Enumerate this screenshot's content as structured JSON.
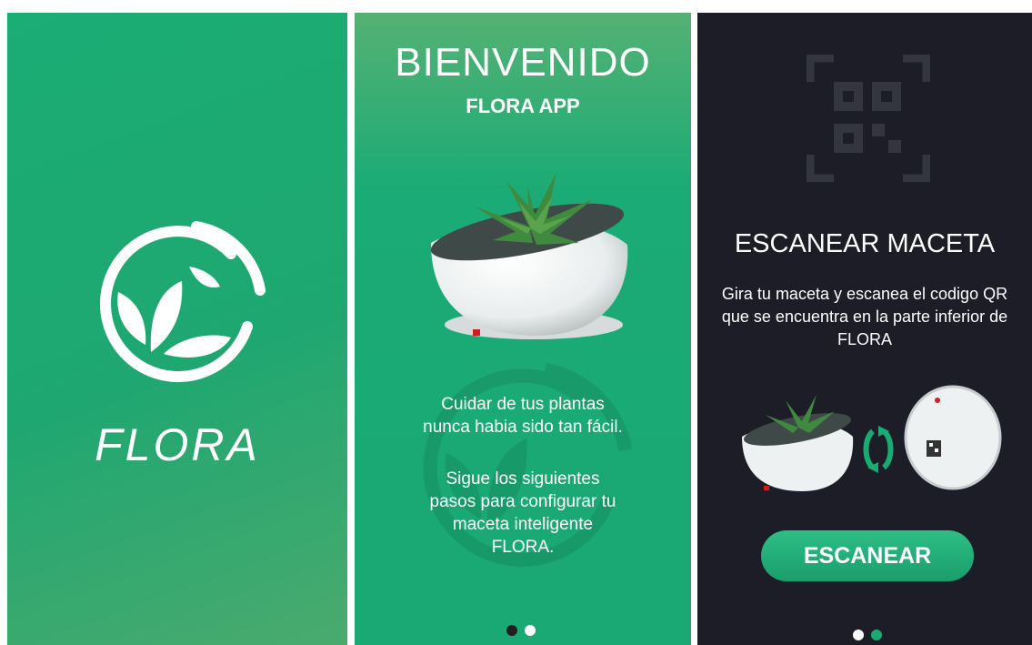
{
  "splash": {
    "brand": "FLORA",
    "logo_icon": "leaf-logo-icon"
  },
  "welcome": {
    "title": "BIENVENIDO",
    "subtitle": "FLORA APP",
    "paragraph1": "Cuidar de tus plantas nunca habia sido tan fácil.",
    "paragraph2": "Sigue los siguientes pasos para configurar tu maceta inteligente FLORA.",
    "page_indicator": {
      "count": 2,
      "active": 1
    }
  },
  "scan": {
    "title": "ESCANEAR MACETA",
    "description": "Gira tu maceta y escanea el codigo QR que se encuentra en la parte inferior de FLORA",
    "button_label": "ESCANEAR",
    "icons": [
      "qr-scan-icon",
      "rotate-icon"
    ],
    "page_indicator": {
      "count": 2,
      "active": 2
    }
  },
  "colors": {
    "green": "#1aab74",
    "dark": "#1c1d26",
    "inactive_dot": "#ffffff",
    "active_dot_dark": "#1f1f1f",
    "active_dot_green": "#1aab74"
  }
}
